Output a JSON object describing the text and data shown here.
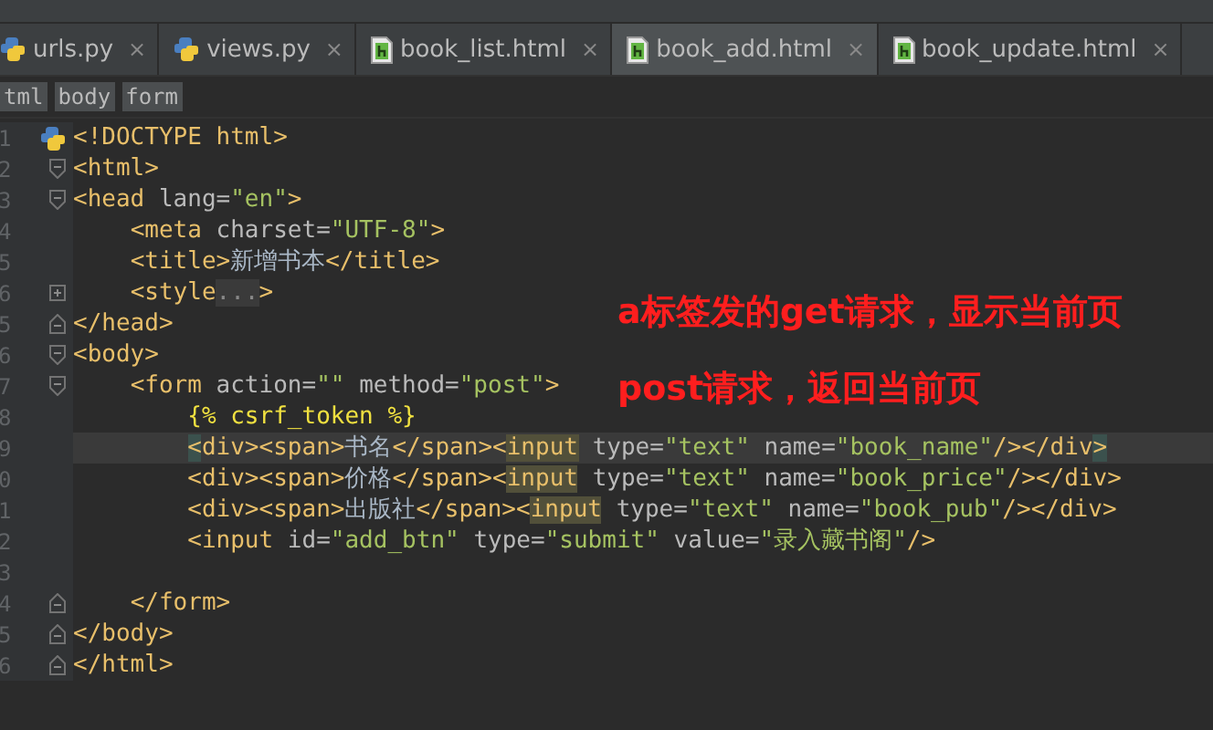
{
  "tabs": [
    {
      "label": "urls.py",
      "kind": "python",
      "close": "×",
      "selected": false
    },
    {
      "label": "views.py",
      "kind": "python",
      "close": "×",
      "selected": false
    },
    {
      "label": "book_list.html",
      "kind": "html",
      "close": "×",
      "selected": false
    },
    {
      "label": "book_add.html",
      "kind": "html",
      "close": "×",
      "selected": true
    },
    {
      "label": "book_update.html",
      "kind": "html",
      "close": "×",
      "selected": false
    }
  ],
  "breadcrumbs": [
    "tml",
    "body",
    "form"
  ],
  "lines": [
    {
      "number": "1",
      "kind": "file",
      "current": false,
      "tokens": [
        {
          "kind": "tag",
          "text": "<!DOCTYPE html>"
        }
      ]
    },
    {
      "number": "2",
      "kind": "open",
      "current": false,
      "tokens": [
        {
          "kind": "tag",
          "text": "<html>"
        }
      ]
    },
    {
      "number": "3",
      "kind": "open",
      "current": false,
      "tokens": [
        {
          "kind": "tag",
          "text": "<head"
        },
        {
          "kind": "attr",
          "text": " lang="
        },
        {
          "kind": "string",
          "text": "\"en\""
        },
        {
          "kind": "tag",
          "text": ">"
        }
      ]
    },
    {
      "number": "4",
      "kind": "plain",
      "current": false,
      "tokens": [
        {
          "kind": "tag",
          "text": "    <meta"
        },
        {
          "kind": "attr",
          "text": " charset="
        },
        {
          "kind": "string",
          "text": "\"UTF-8\""
        },
        {
          "kind": "tag",
          "text": ">"
        }
      ]
    },
    {
      "number": "5",
      "kind": "plain",
      "current": false,
      "tokens": [
        {
          "kind": "tag",
          "text": "    <title>"
        },
        {
          "kind": "text",
          "text": "新增书本"
        },
        {
          "kind": "tag",
          "text": "</title>"
        }
      ]
    },
    {
      "number": "6",
      "kind": "collapsed",
      "current": false,
      "tokens": [
        {
          "kind": "tag",
          "text": "    <style"
        },
        {
          "kind": "folded",
          "text": "..."
        },
        {
          "kind": "tag",
          "text": ">"
        }
      ]
    },
    {
      "number": "5",
      "kind": "close",
      "current": false,
      "tokens": [
        {
          "kind": "tag",
          "text": "</head>"
        }
      ]
    },
    {
      "number": "6",
      "kind": "open",
      "current": false,
      "tokens": [
        {
          "kind": "tag",
          "text": "<body>"
        }
      ]
    },
    {
      "number": "7",
      "kind": "open",
      "current": false,
      "tokens": [
        {
          "kind": "tag",
          "text": "    <form"
        },
        {
          "kind": "attr",
          "text": " action="
        },
        {
          "kind": "string",
          "text": "\"\""
        },
        {
          "kind": "attr",
          "text": " method="
        },
        {
          "kind": "string",
          "text": "\"post\""
        },
        {
          "kind": "tag",
          "text": ">"
        }
      ]
    },
    {
      "number": "8",
      "kind": "plain",
      "current": false,
      "tokens": [
        {
          "kind": "template",
          "text": "        {% csrf_token %}"
        }
      ]
    },
    {
      "number": "9",
      "kind": "plain",
      "current": true,
      "tokens": [
        {
          "kind": "brace",
          "text": "        <"
        },
        {
          "kind": "tag",
          "text": "div><span>"
        },
        {
          "kind": "text",
          "text": "书名"
        },
        {
          "kind": "tag",
          "text": "</span><"
        },
        {
          "kind": "usage",
          "text": "input"
        },
        {
          "kind": "attr",
          "text": " type="
        },
        {
          "kind": "string",
          "text": "\"text\""
        },
        {
          "kind": "attr",
          "text": " name="
        },
        {
          "kind": "string",
          "text": "\"book_name\""
        },
        {
          "kind": "tag",
          "text": "/></div"
        },
        {
          "kind": "brace",
          "text": ">"
        }
      ]
    },
    {
      "number": "0",
      "kind": "plain",
      "current": false,
      "tokens": [
        {
          "kind": "tag",
          "text": "        <div><span>"
        },
        {
          "kind": "text",
          "text": "价格"
        },
        {
          "kind": "tag",
          "text": "</span><"
        },
        {
          "kind": "usage",
          "text": "input"
        },
        {
          "kind": "attr",
          "text": " type="
        },
        {
          "kind": "string",
          "text": "\"text\""
        },
        {
          "kind": "attr",
          "text": " name="
        },
        {
          "kind": "string",
          "text": "\"book_price\""
        },
        {
          "kind": "tag",
          "text": "/></div>"
        }
      ]
    },
    {
      "number": "1",
      "kind": "plain",
      "current": false,
      "tokens": [
        {
          "kind": "tag",
          "text": "        <div><span>"
        },
        {
          "kind": "text",
          "text": "出版社"
        },
        {
          "kind": "tag",
          "text": "</span><"
        },
        {
          "kind": "usage",
          "text": "input"
        },
        {
          "kind": "attr",
          "text": " type="
        },
        {
          "kind": "string",
          "text": "\"text\""
        },
        {
          "kind": "attr",
          "text": " name="
        },
        {
          "kind": "string",
          "text": "\"book_pub\""
        },
        {
          "kind": "tag",
          "text": "/></div>"
        }
      ]
    },
    {
      "number": "2",
      "kind": "plain",
      "current": false,
      "tokens": [
        {
          "kind": "tag",
          "text": "        <input"
        },
        {
          "kind": "attr",
          "text": " id="
        },
        {
          "kind": "string",
          "text": "\"add_btn\""
        },
        {
          "kind": "attr",
          "text": " type="
        },
        {
          "kind": "string",
          "text": "\"submit\""
        },
        {
          "kind": "attr",
          "text": " value="
        },
        {
          "kind": "string",
          "text": "\"录入藏书阁\""
        },
        {
          "kind": "tag",
          "text": "/>"
        }
      ]
    },
    {
      "number": "3",
      "kind": "plain",
      "current": false
    },
    {
      "number": "4",
      "kind": "close",
      "current": false,
      "tokens": [
        {
          "kind": "tag",
          "text": "    </form>"
        }
      ]
    },
    {
      "number": "5",
      "kind": "close",
      "current": false,
      "tokens": [
        {
          "kind": "tag",
          "text": "</body>"
        }
      ]
    },
    {
      "number": "6",
      "kind": "close",
      "current": false,
      "tokens": [
        {
          "kind": "tag",
          "text": "</html>"
        }
      ]
    }
  ],
  "annotations": [
    "a标签发的get请求，显示当前页",
    "post请求，返回当前页"
  ]
}
